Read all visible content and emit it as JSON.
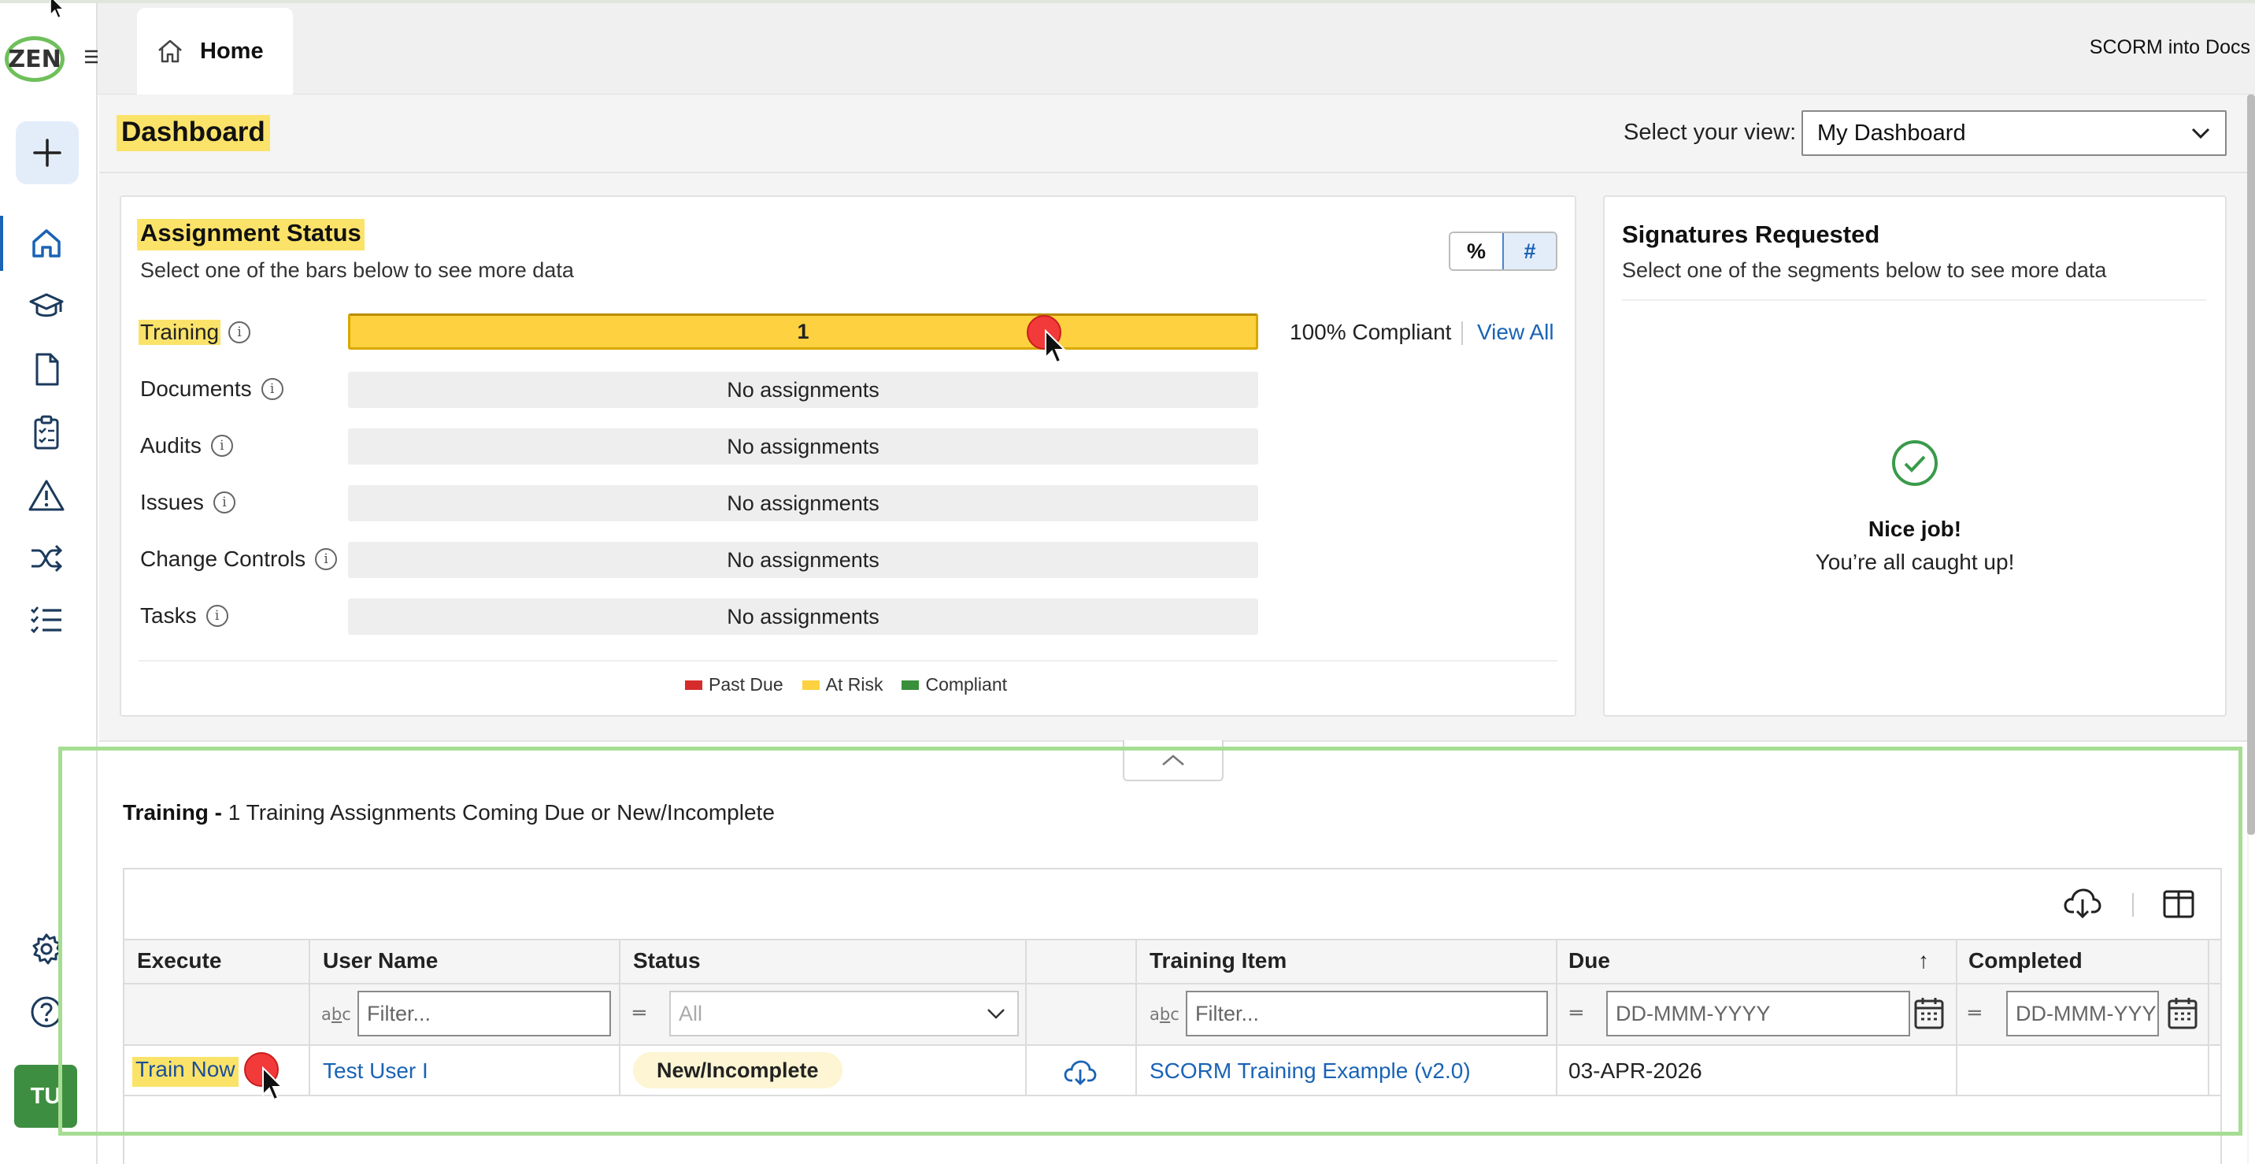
{
  "app": {
    "logo_text": "ZEN",
    "home_tab_label": "Home",
    "top_right_label": "SCORM into Docs",
    "avatar_initials": "TU"
  },
  "dashboard": {
    "title": "Dashboard",
    "view_label": "Select your view:",
    "view_selected": "My Dashboard"
  },
  "assignment_status": {
    "title": "Assignment Status",
    "subtitle": "Select one of the bars below to see more data",
    "toggle_percent": "%",
    "toggle_number": "#",
    "rows": [
      {
        "label": "Training",
        "bar_text": "1",
        "status": "at-risk"
      },
      {
        "label": "Documents",
        "bar_text": "No assignments"
      },
      {
        "label": "Audits",
        "bar_text": "No assignments"
      },
      {
        "label": "Issues",
        "bar_text": "No assignments"
      },
      {
        "label": "Change Controls",
        "bar_text": "No assignments"
      },
      {
        "label": "Tasks",
        "bar_text": "No assignments"
      }
    ],
    "training_compliance": "100% Compliant",
    "view_all": "View All",
    "legend": [
      {
        "label": "Past Due",
        "color": "#d62b2b"
      },
      {
        "label": "At Risk",
        "color": "#fdd13f"
      },
      {
        "label": "Compliant",
        "color": "#3a8f3a"
      }
    ]
  },
  "signatures": {
    "title": "Signatures Requested",
    "subtitle": "Select one of the segments below to see more data",
    "empty_title": "Nice job!",
    "empty_subtitle": "You’re all caught up!"
  },
  "training_panel": {
    "title_bold": "Training -",
    "title_rest": " 1 Training Assignments Coming Due or New/Incomplete",
    "columns": [
      "Execute",
      "User Name",
      "Status",
      "",
      "Training Item",
      "Due",
      "Completed"
    ],
    "sort_indicator": "↑",
    "filters": {
      "user_name": "Filter...",
      "status": "All",
      "training_item": "Filter...",
      "due": "DD-MMM-YYYY",
      "completed": "DD-MMM-YYY"
    },
    "rows": [
      {
        "execute": "Train Now",
        "user_name": "Test User I",
        "status": "New/Incomplete",
        "training_item": "SCORM Training Example (v2.0)",
        "due": "03-APR-2026",
        "completed": ""
      }
    ]
  },
  "icons": {
    "rail": [
      "menu-icon",
      "plus-icon",
      "home-icon",
      "graduation-cap-icon",
      "document-icon",
      "clipboard-checklist-icon",
      "warning-icon",
      "shuffle-icon",
      "task-list-icon",
      "gear-icon",
      "help-icon"
    ],
    "accent_color": "#1a63b5",
    "highlight_color": "#fbe36a"
  }
}
